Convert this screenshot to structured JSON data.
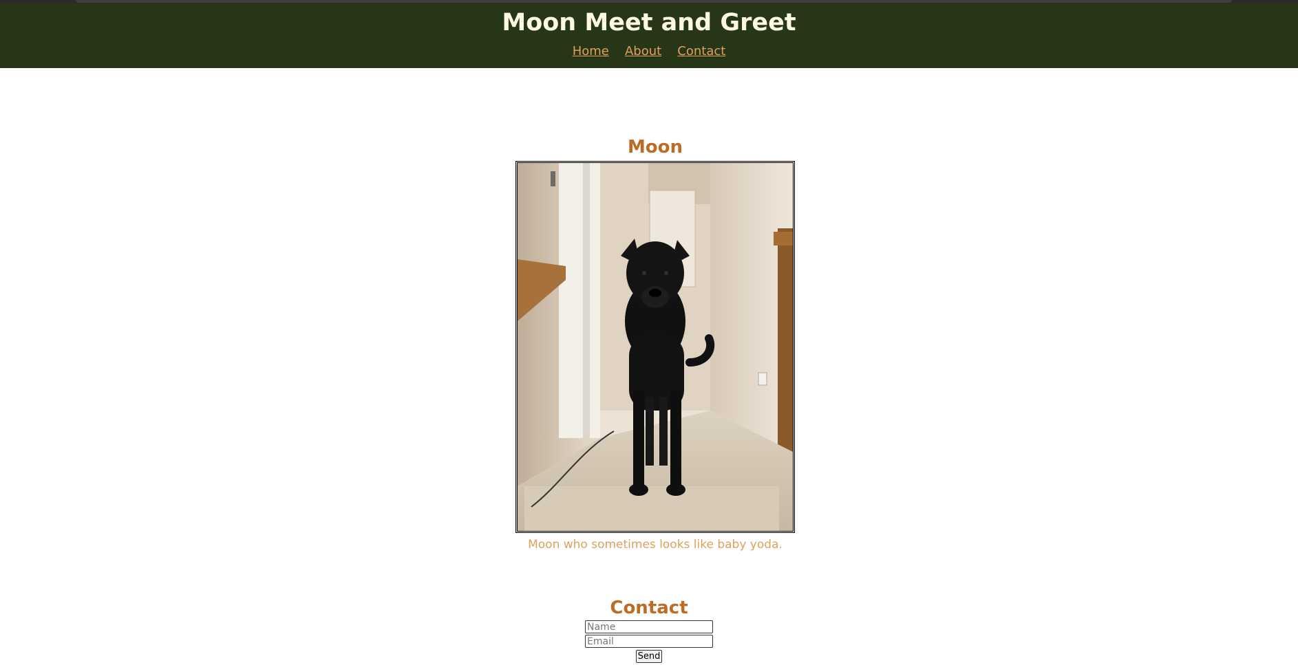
{
  "header": {
    "title": "Moon Meet and Greet",
    "nav": [
      "Home",
      "About",
      "Contact"
    ]
  },
  "profile": {
    "name": "Moon",
    "caption": "Moon who sometimes looks like baby yoda."
  },
  "contact": {
    "heading": "Contact",
    "name_placeholder": "Name",
    "email_placeholder": "Email",
    "send_label": "Send"
  },
  "colors": {
    "header_bg": "#283618",
    "title": "#fefae0",
    "accent": "#bc6c25",
    "link": "#dda15e"
  }
}
